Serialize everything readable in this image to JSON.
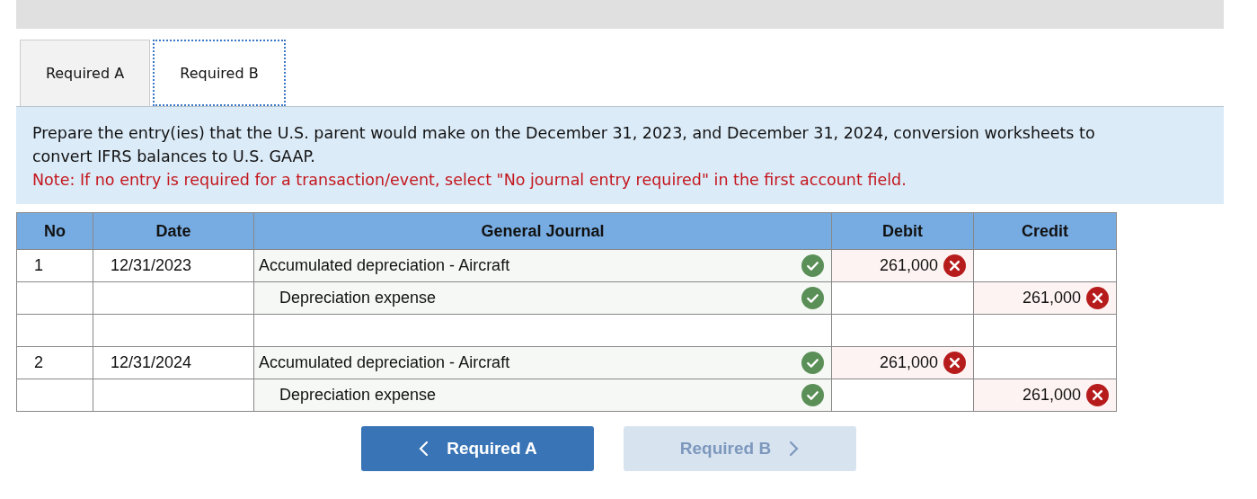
{
  "tabs": [
    {
      "label": "Required A",
      "selected": false
    },
    {
      "label": "Required B",
      "selected": true
    }
  ],
  "instructions": {
    "text": "Prepare the entry(ies) that the U.S. parent would make on the December 31, 2023, and December 31, 2024, conversion worksheets to convert IFRS balances to U.S. GAAP.",
    "note": "Note: If no entry is required for a transaction/event, select \"No journal entry required\" in the first account field."
  },
  "table": {
    "columns": [
      "No",
      "Date",
      "General Journal",
      "Debit",
      "Credit"
    ],
    "rows": [
      {
        "kind": "debit",
        "no": "1",
        "date": "12/31/2023",
        "account": "Accumulated depreciation - Aircraft",
        "account_correct": true,
        "amount": "261,000",
        "amount_correct": false
      },
      {
        "kind": "credit",
        "account": "Depreciation expense",
        "account_correct": true,
        "amount": "261,000",
        "amount_correct": false
      },
      {
        "kind": "blank"
      },
      {
        "kind": "debit",
        "no": "2",
        "date": "12/31/2024",
        "account": "Accumulated depreciation - Aircraft",
        "account_correct": true,
        "amount": "261,000",
        "amount_correct": false
      },
      {
        "kind": "credit",
        "account": "Depreciation expense",
        "account_correct": true,
        "amount": "261,000",
        "amount_correct": false
      }
    ]
  },
  "nav_buttons": [
    {
      "label": "Required A",
      "kind": "prev",
      "disabled": false
    },
    {
      "label": "Required B",
      "kind": "next",
      "disabled": true
    }
  ]
}
